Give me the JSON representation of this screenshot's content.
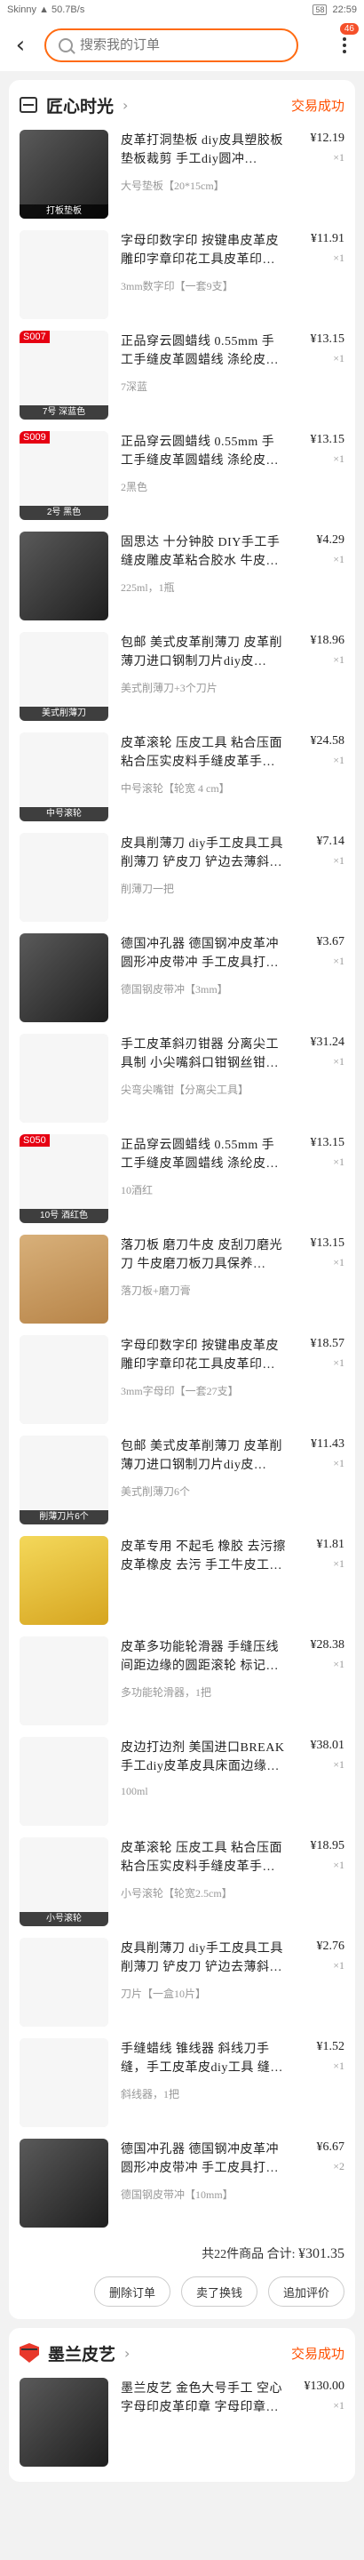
{
  "status_bar": {
    "left": "Skinny ▲ 50.7B/s",
    "battery": "58",
    "time": "22:59"
  },
  "search": {
    "placeholder": "搜索我的订单"
  },
  "header": {
    "cart_badge": "46"
  },
  "order1": {
    "shop": "匠心时光",
    "status": "交易成功",
    "items": [
      {
        "title": "皮革打洞垫板 diy皮具塑胶板垫板裁剪 手工diy圆冲…",
        "spec": "大号垫板【20*15cm】",
        "price": "¥12.19",
        "qty": "×1",
        "art": "dark",
        "label": "打板垫板"
      },
      {
        "title": "字母印数字印 按键串皮革皮雕印字章印花工具皮革印章…",
        "spec": "3mm数字印【一套9支】",
        "price": "¥11.91",
        "qty": "×1",
        "art": "white",
        "label": ""
      },
      {
        "title": "正品穿云圆蜡线 0.55mm 手工手缝皮革圆蜡线 涤纶皮具…",
        "spec": "7深蓝",
        "price": "¥13.15",
        "qty": "×1",
        "art": "white",
        "label": "7号 深蓝色",
        "tag": "S007"
      },
      {
        "title": "正品穿云圆蜡线 0.55mm 手工手缝皮革圆蜡线 涤纶皮具…",
        "spec": "2黑色",
        "price": "¥13.15",
        "qty": "×1",
        "art": "white",
        "label": "2号 黑色",
        "tag": "S009"
      },
      {
        "title": "固思达 十分钟胶 DIY手工手缝皮雕皮革粘合胶水 牛皮革粘…",
        "spec": "225ml，1瓶",
        "price": "¥4.29",
        "qty": "×1",
        "art": "dark",
        "label": ""
      },
      {
        "title": "包邮 美式皮革削薄刀 皮革削薄刀进口钢制刀片diy皮…",
        "spec": "美式削薄刀+3个刀片",
        "price": "¥18.96",
        "qty": "×1",
        "art": "white",
        "label": "美式削薄刀"
      },
      {
        "title": "皮革滚轮 压皮工具 粘合压面 粘合压实皮料手缝皮革手…",
        "spec": "中号滚轮【轮宽 4 cm】",
        "price": "¥24.58",
        "qty": "×1",
        "art": "white",
        "label": "中号滚轮"
      },
      {
        "title": "皮具削薄刀 diy手工皮具工具削薄刀 铲皮刀 铲边去薄斜铲…",
        "spec": "削薄刀一把",
        "price": "¥7.14",
        "qty": "×1",
        "art": "white",
        "label": ""
      },
      {
        "title": "德国冲孔器 德国钢冲皮革冲圆形冲皮带冲 手工皮具打孔…",
        "spec": "德国钢皮带冲【3mm】",
        "price": "¥3.67",
        "qty": "×1",
        "art": "dark",
        "label": ""
      },
      {
        "title": "手工皮革斜刃钳器 分离尖工具制 小尖嘴斜口钳钢丝钳 剪…",
        "spec": "尖弯尖嘴钳【分离尖工具】",
        "price": "¥31.24",
        "qty": "×1",
        "art": "white",
        "label": ""
      },
      {
        "title": "正品穿云圆蜡线 0.55mm 手工手缝皮革圆蜡线 涤纶皮具…",
        "spec": "10酒红",
        "price": "¥13.15",
        "qty": "×1",
        "art": "white",
        "label": "10号 酒红色",
        "tag": "S050"
      },
      {
        "title": "落刀板 磨刀牛皮 皮刮刀磨光刀 牛皮磨刀板刀具保养…",
        "spec": "落刀板+磨刀膏",
        "price": "¥13.15",
        "qty": "×1",
        "art": "leather",
        "label": ""
      },
      {
        "title": "字母印数字印 按键串皮革皮雕印字章印花工具皮革印章…",
        "spec": "3mm字母印【一套27支】",
        "price": "¥18.57",
        "qty": "×1",
        "art": "white",
        "label": ""
      },
      {
        "title": "包邮 美式皮革削薄刀 皮革削薄刀进口钢制刀片diy皮…",
        "spec": "美式削薄刀6个",
        "price": "¥11.43",
        "qty": "×1",
        "art": "white",
        "label": "削薄刀片6个"
      },
      {
        "title": "皮革专用 不起毛 橡胶 去污擦 皮革橡皮 去污 手工牛皮工具皮…",
        "spec": "",
        "price": "¥1.81",
        "qty": "×1",
        "art": "yellow",
        "label": ""
      },
      {
        "title": "皮革多功能轮滑器 手缝压线 间距边缘的圆距滚轮 标记线…",
        "spec": "多功能轮滑器，1把",
        "price": "¥28.38",
        "qty": "×1",
        "art": "white",
        "label": ""
      },
      {
        "title": "皮边打边剂 美国进口BREAK手工diy皮革皮具床面边缘…",
        "spec": "100ml",
        "price": "¥38.01",
        "qty": "×1",
        "art": "white",
        "label": ""
      },
      {
        "title": "皮革滚轮 压皮工具 粘合压面 粘合压实皮料手缝皮革手…",
        "spec": "小号滚轮【轮宽2.5cm】",
        "price": "¥18.95",
        "qty": "×1",
        "art": "white",
        "label": "小号滚轮"
      },
      {
        "title": "皮具削薄刀 diy手工皮具工具削薄刀 铲皮刀 铲边去薄斜铲…",
        "spec": "刀片【一盒10片】",
        "price": "¥2.76",
        "qty": "×1",
        "art": "white",
        "label": ""
      },
      {
        "title": "手缝蜡线 锥线器 斜线刀手缝，手工皮革皮diy工具 缝合…",
        "spec": "斜线器，1把",
        "price": "¥1.52",
        "qty": "×1",
        "art": "white",
        "label": ""
      },
      {
        "title": "德国冲孔器 德国钢冲皮革冲圆形冲皮带冲 手工皮具打孔…",
        "spec": "德国钢皮带冲【10mm】",
        "price": "¥6.67",
        "qty": "×2",
        "art": "dark",
        "label": ""
      }
    ],
    "total_label": "共22件商品  合计:",
    "total_value": "¥301.35",
    "buttons": [
      "删除订单",
      "卖了换钱",
      "追加评价"
    ]
  },
  "order2": {
    "shop": "墨兰皮艺",
    "status": "交易成功",
    "items": [
      {
        "title": "墨兰皮艺 金色大号手工 空心字母印皮革印章 字母印章…",
        "spec": "",
        "price": "¥130.00",
        "qty": "×1",
        "art": "dark",
        "label": ""
      }
    ]
  }
}
